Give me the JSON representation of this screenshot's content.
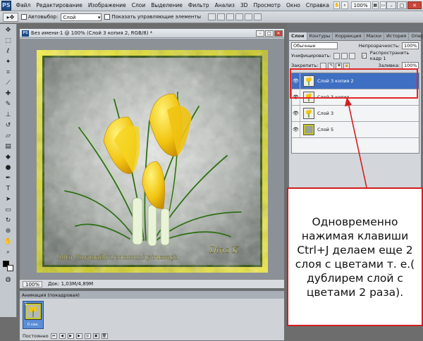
{
  "app": {
    "logo": "PS"
  },
  "menu": {
    "items": [
      "Файл",
      "Редактирование",
      "Изображение",
      "Слои",
      "Выделение",
      "Фильтр",
      "Анализ",
      "3D",
      "Просмотр",
      "Окно",
      "Справка"
    ],
    "zoom": "100%",
    "window_buttons": {
      "minimize": "–",
      "maximize": "□",
      "close": "✕"
    }
  },
  "options_bar": {
    "tool_glyph": "▸✥",
    "autoselect_label": "Автовыбор:",
    "autoselect_value": "Слой",
    "transform_label": "Показать управляющие элементы"
  },
  "document": {
    "title": "Без имени-1 @ 100% (Слой 3 копия 2, RGB/8) *",
    "status_zoom": "100%",
    "status_doc": "Док: 1,03M/4,89M",
    "watermark": "http://my.mail.ru/community/russagh",
    "signature": "Dina K."
  },
  "layers_panel": {
    "tabs": [
      "Слои",
      "Контуры",
      "Коррекция",
      "Маски",
      "История",
      "Операции"
    ],
    "blend_mode": "Обычные",
    "opacity_label": "Непрозрачность:",
    "opacity_value": "100%",
    "unify_label": "Унифицировать:",
    "propagate_label": "Распространить кадр 1",
    "lock_label": "Закрепить:",
    "fill_label": "Заливка:",
    "fill_value": "100%",
    "layers": [
      {
        "name": "Слой 3 копия 2",
        "selected": true,
        "visible": true
      },
      {
        "name": "Слой 3 копия",
        "selected": false,
        "visible": true
      },
      {
        "name": "Слой 3",
        "selected": false,
        "visible": true
      },
      {
        "name": "Слой 5",
        "selected": false,
        "visible": true
      }
    ]
  },
  "animation_panel": {
    "title": "Анимация (покадровая)",
    "frame_number": "1",
    "frame_delay": "0 сек.",
    "loop_label": "Постоянно"
  },
  "annotation": {
    "text": "Одновременно нажимая клавиши Ctrl+J делаем еще 2 слоя с цветами т. е.( дублирем слой с цветами 2 раза)."
  },
  "colors": {
    "highlight": "#e32626",
    "selection": "#3f6fc2"
  }
}
